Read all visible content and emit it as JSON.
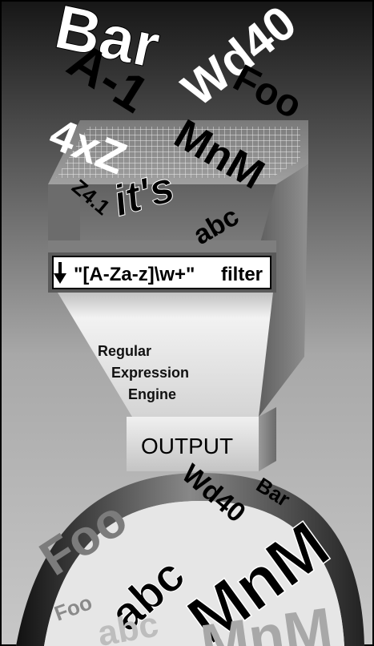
{
  "input_words": [
    "Bar",
    "Wd40",
    "A-1",
    "Foo",
    "MnM",
    "4xZ",
    "it's",
    "abc",
    "Z4.1"
  ],
  "filter": {
    "arrow_icon": "down-arrow-icon",
    "pattern": "\"[A-Za-z]\\w+\"",
    "label": "filter"
  },
  "engine": {
    "line1": "Regular",
    "line2": "Expression",
    "line3": "Engine"
  },
  "output": {
    "label": "OUTPUT"
  },
  "output_words": [
    "Wd40",
    "Bar",
    "Foo",
    "abc",
    "MnM",
    "Foo",
    "abc",
    "MnM"
  ],
  "colors": {
    "background_top": "#1a1a1a",
    "background_bottom": "#bdbdbd",
    "funnel_light": "#e0e0e0",
    "funnel_dark": "#6e6e6e",
    "ink": "#000000",
    "paper": "#ffffff"
  }
}
